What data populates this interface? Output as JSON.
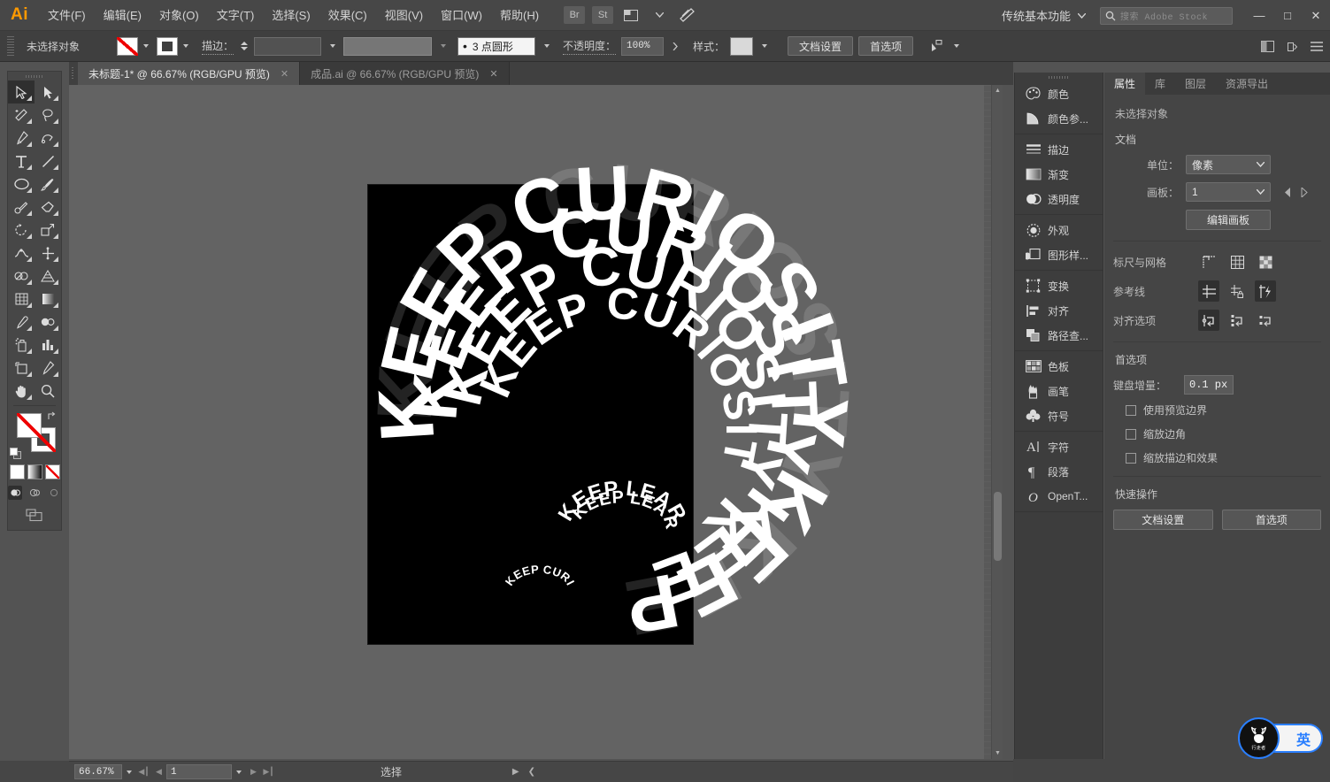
{
  "app": {
    "logo": "Ai"
  },
  "menubar": {
    "items": [
      {
        "label": "文件(F)",
        "name": "menu-file"
      },
      {
        "label": "编辑(E)",
        "name": "menu-edit"
      },
      {
        "label": "对象(O)",
        "name": "menu-object"
      },
      {
        "label": "文字(T)",
        "name": "menu-type"
      },
      {
        "label": "选择(S)",
        "name": "menu-select"
      },
      {
        "label": "效果(C)",
        "name": "menu-effect"
      },
      {
        "label": "视图(V)",
        "name": "menu-view"
      },
      {
        "label": "窗口(W)",
        "name": "menu-window"
      },
      {
        "label": "帮助(H)",
        "name": "menu-help"
      }
    ],
    "bridge_label": "Br",
    "stock_label": "St",
    "arrange_icon": "arrange-documents-icon",
    "workspace": "传统基本功能",
    "search_placeholder": "搜索 Adobe Stock",
    "window_buttons": {
      "minimize": "—",
      "maximize": "□",
      "close": "✕"
    }
  },
  "controlbar": {
    "selection_status": "未选择对象",
    "fill_label": "fill-swatch",
    "stroke_label": "stroke-swatch",
    "stroke_text": "描边：",
    "stroke_weight": "",
    "stroke_profile": "",
    "brush_definition": "3 点圆形",
    "opacity_label": "不透明度：",
    "opacity_value": "100%",
    "style_label": "样式：",
    "doc_setup": "文档设置",
    "preferences": "首选项",
    "align_icon": "align-to-selection-icon"
  },
  "tabs": [
    {
      "title": "未标题-1* @ 66.67% (RGB/GPU 预览)",
      "active": true,
      "close": "✕"
    },
    {
      "title": "成品.ai @ 66.67% (RGB/GPU 预览)",
      "active": false,
      "close": "✕"
    }
  ],
  "toolbar": {
    "tools": [
      {
        "name": "selection-tool",
        "selected": true
      },
      {
        "name": "direct-selection-tool",
        "selected": false
      },
      {
        "name": "magic-wand-tool",
        "selected": false
      },
      {
        "name": "lasso-tool",
        "selected": false
      },
      {
        "name": "pen-tool",
        "selected": false
      },
      {
        "name": "curvature-tool",
        "selected": false
      },
      {
        "name": "type-tool",
        "selected": false
      },
      {
        "name": "line-segment-tool",
        "selected": false
      },
      {
        "name": "ellipse-tool",
        "selected": false
      },
      {
        "name": "paintbrush-tool",
        "selected": false
      },
      {
        "name": "shaper-tool",
        "selected": false
      },
      {
        "name": "eraser-tool",
        "selected": false
      },
      {
        "name": "rotate-tool",
        "selected": false
      },
      {
        "name": "scale-tool",
        "selected": false
      },
      {
        "name": "width-tool",
        "selected": false
      },
      {
        "name": "free-transform-tool",
        "selected": false
      },
      {
        "name": "shape-builder-tool",
        "selected": false
      },
      {
        "name": "perspective-grid-tool",
        "selected": false
      },
      {
        "name": "mesh-tool",
        "selected": false
      },
      {
        "name": "gradient-tool",
        "selected": false
      },
      {
        "name": "eyedropper-tool",
        "selected": false
      },
      {
        "name": "blend-tool",
        "selected": false
      },
      {
        "name": "symbol-sprayer-tool",
        "selected": false
      },
      {
        "name": "column-graph-tool",
        "selected": false
      },
      {
        "name": "artboard-tool",
        "selected": false
      },
      {
        "name": "slice-tool",
        "selected": false
      },
      {
        "name": "hand-tool",
        "selected": false
      },
      {
        "name": "zoom-tool",
        "selected": false
      }
    ],
    "fill_color": "#ffffff",
    "stroke_color": "#ffffff",
    "fill_is_none": true,
    "stroke_is_none": true,
    "color_modes": [
      "color-mode-plain",
      "color-mode-gradient",
      "color-mode-none"
    ],
    "draw_modes": [
      "draw-normal",
      "draw-behind",
      "draw-inside"
    ],
    "screen_mode": "change-screen-mode-icon"
  },
  "artwork": {
    "artboard_background": "#000000",
    "text_color": "#ffffff",
    "spiral_large_text": "KEEP CURIOSITY",
    "spiral_medium_text": "KEEP LEARNING",
    "spiral_small_text": "KEEP CURIOSITY"
  },
  "dock": {
    "groups": [
      [
        {
          "label": "颜色",
          "icon": "color-palette-icon",
          "name": "dock-color"
        },
        {
          "label": "颜色参...",
          "icon": "color-guide-icon",
          "name": "dock-color-guide"
        }
      ],
      [
        {
          "label": "描边",
          "icon": "stroke-icon",
          "name": "dock-stroke"
        },
        {
          "label": "渐变",
          "icon": "gradient-icon",
          "name": "dock-gradient"
        },
        {
          "label": "透明度",
          "icon": "transparency-icon",
          "name": "dock-transparency"
        }
      ],
      [
        {
          "label": "外观",
          "icon": "appearance-icon",
          "name": "dock-appearance"
        },
        {
          "label": "图形样...",
          "icon": "graphic-styles-icon",
          "name": "dock-graphic-styles"
        }
      ],
      [
        {
          "label": "变换",
          "icon": "transform-icon",
          "name": "dock-transform"
        },
        {
          "label": "对齐",
          "icon": "align-icon",
          "name": "dock-align"
        },
        {
          "label": "路径查...",
          "icon": "pathfinder-icon",
          "name": "dock-pathfinder"
        }
      ],
      [
        {
          "label": "色板",
          "icon": "swatches-icon",
          "name": "dock-swatches"
        },
        {
          "label": "画笔",
          "icon": "brushes-icon",
          "name": "dock-brushes"
        },
        {
          "label": "符号",
          "icon": "symbols-icon",
          "name": "dock-symbols"
        }
      ],
      [
        {
          "label": "字符",
          "icon": "character-icon",
          "name": "dock-character"
        },
        {
          "label": "段落",
          "icon": "paragraph-icon",
          "name": "dock-paragraph"
        },
        {
          "label": "OpenT...",
          "icon": "opentype-icon",
          "name": "dock-opentype"
        }
      ]
    ]
  },
  "properties": {
    "tabs": [
      {
        "label": "属性",
        "active": true
      },
      {
        "label": "库",
        "active": false
      },
      {
        "label": "图层",
        "active": false
      },
      {
        "label": "资源导出",
        "active": false
      }
    ],
    "no_selection": "未选择对象",
    "document_heading": "文档",
    "units_label": "单位：",
    "units_value": "像素",
    "artboard_label": "画板：",
    "artboard_value": "1",
    "edit_artboards": "编辑画板",
    "rulers_grid_label": "标尺与网格",
    "rulers_grid_icons": [
      "show-rulers-icon",
      "show-grid-icon",
      "show-transparency-grid-icon"
    ],
    "guides_label": "参考线",
    "guides_icons": [
      "show-guides-icon",
      "lock-guides-icon",
      "smart-guides-icon"
    ],
    "snap_label": "对齐选项",
    "snap_icons": [
      "snap-to-point-icon",
      "snap-to-grid-icon",
      "snap-to-pixel-icon"
    ],
    "preferences_heading": "首选项",
    "keyboard_increment_label": "键盘增量：",
    "keyboard_increment_value": "0.1 px",
    "checkboxes": [
      {
        "label": "使用预览边界",
        "checked": false
      },
      {
        "label": "缩放边角",
        "checked": false
      },
      {
        "label": "缩放描边和效果",
        "checked": false
      }
    ],
    "quick_actions_heading": "快速操作",
    "quick_actions": [
      "文档设置",
      "首选项"
    ]
  },
  "statusbar": {
    "zoom_value": "66.67%",
    "artboard_number": "1",
    "status_text": "选择"
  },
  "ime": {
    "mode": "英",
    "brand": "行走者"
  },
  "colors": {
    "accent": "#ff9a00",
    "ime_blue": "#2a7fff",
    "panel_bg": "#454545",
    "canvas_bg": "#636363",
    "artboard": "#000000"
  }
}
